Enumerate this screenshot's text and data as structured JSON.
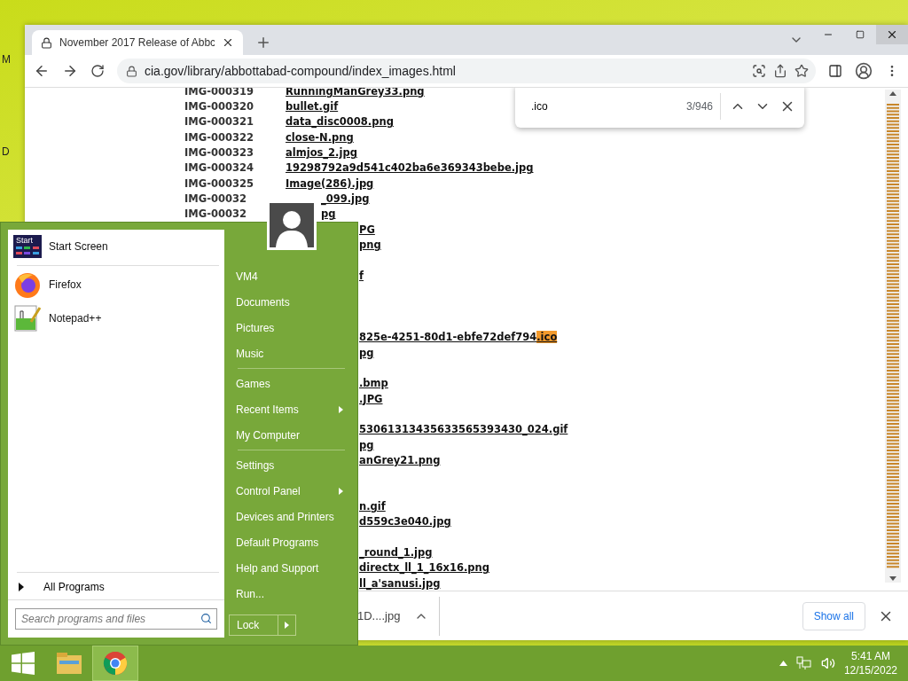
{
  "desktop_labels": [
    "M",
    "D"
  ],
  "browser": {
    "tab": {
      "title": "November 2017 Release of Abbc",
      "selected": true
    },
    "address": "cia.gov/library/abbottabad-compound/index_images.html",
    "find": {
      "query": ".ico",
      "count": "3/946"
    },
    "rows": [
      {
        "kind": "full",
        "id": "IMG-000319",
        "name": "RunningManGrey33.png"
      },
      {
        "kind": "full",
        "id": "IMG-000320",
        "name": "bullet.gif"
      },
      {
        "kind": "full",
        "id": "IMG-000321",
        "name": "data_disc0008.png"
      },
      {
        "kind": "full",
        "id": "IMG-000322",
        "name": "close-N.png"
      },
      {
        "kind": "full",
        "id": "IMG-000323",
        "name": "almjos_2.jpg"
      },
      {
        "kind": "full",
        "id": "IMG-000324",
        "name": "19298792a9d541c402ba6e369343bebe.jpg"
      },
      {
        "kind": "full",
        "id": "IMG-000325",
        "name": "Image(286).jpg"
      },
      {
        "kind": "partial",
        "id": "IMG-00032",
        "text": "_099.jpg"
      },
      {
        "kind": "partial",
        "id": "IMG-00032",
        "text": "pg"
      },
      {
        "kind": "tail",
        "text": "PG"
      },
      {
        "kind": "tail",
        "text": "png"
      },
      {
        "kind": "hidden"
      },
      {
        "kind": "tail",
        "text": "f"
      },
      {
        "kind": "hidden"
      },
      {
        "kind": "hidden"
      },
      {
        "kind": "hidden"
      },
      {
        "kind": "tail",
        "text": "825e-4251-80d1-ebfe72def794",
        "match": ".ico"
      },
      {
        "kind": "tail",
        "text": "pg"
      },
      {
        "kind": "hidden"
      },
      {
        "kind": "tail",
        "text": ".bmp"
      },
      {
        "kind": "tail",
        "text": ".JPG"
      },
      {
        "kind": "hidden"
      },
      {
        "kind": "tail",
        "text": "53061313435633565393430_024.gif"
      },
      {
        "kind": "tail",
        "text": "pg"
      },
      {
        "kind": "tail",
        "text": "anGrey21.png"
      },
      {
        "kind": "hidden"
      },
      {
        "kind": "hidden"
      },
      {
        "kind": "tail",
        "text": "n.gif"
      },
      {
        "kind": "tail",
        "text": "d559c3e040.jpg"
      },
      {
        "kind": "hidden"
      },
      {
        "kind": "tail",
        "text": "_round_1.jpg"
      },
      {
        "kind": "tail",
        "text": "directx_ll_1_16x16.png"
      },
      {
        "kind": "tail",
        "text": "ll_a'sanusi.jpg"
      }
    ],
    "download": {
      "file": "1D....jpg",
      "button": "Show all"
    }
  },
  "start_menu": {
    "tile_label": "Start",
    "programs": [
      {
        "kind": "start",
        "label": "Start Screen"
      },
      {
        "kind": "firefox",
        "label": "Firefox"
      },
      {
        "kind": "notepad",
        "label": "Notepad++"
      }
    ],
    "all_programs": "All Programs",
    "search": {
      "placeholder": "Search programs and files"
    },
    "place_groups": [
      [
        {
          "label": "VM4",
          "submenu": false
        },
        {
          "label": "Documents",
          "submenu": false
        },
        {
          "label": "Pictures",
          "submenu": false
        },
        {
          "label": "Music",
          "submenu": false
        }
      ],
      [
        {
          "label": "Games",
          "submenu": false
        },
        {
          "label": "Recent Items",
          "submenu": true
        },
        {
          "label": "My Computer",
          "submenu": false
        }
      ],
      [
        {
          "label": "Settings",
          "submenu": false
        },
        {
          "label": "Control Panel",
          "submenu": true
        },
        {
          "label": "Devices and Printers",
          "submenu": false
        },
        {
          "label": "Default Programs",
          "submenu": false
        },
        {
          "label": "Help and Support",
          "submenu": false
        },
        {
          "label": "Run...",
          "submenu": false
        }
      ]
    ],
    "lock": "Lock"
  },
  "taskbar": {
    "apps": [
      {
        "kind": "explorer",
        "selected": false
      },
      {
        "kind": "chrome",
        "selected": true
      }
    ],
    "time": "5:41 AM",
    "date": "12/15/2022"
  }
}
